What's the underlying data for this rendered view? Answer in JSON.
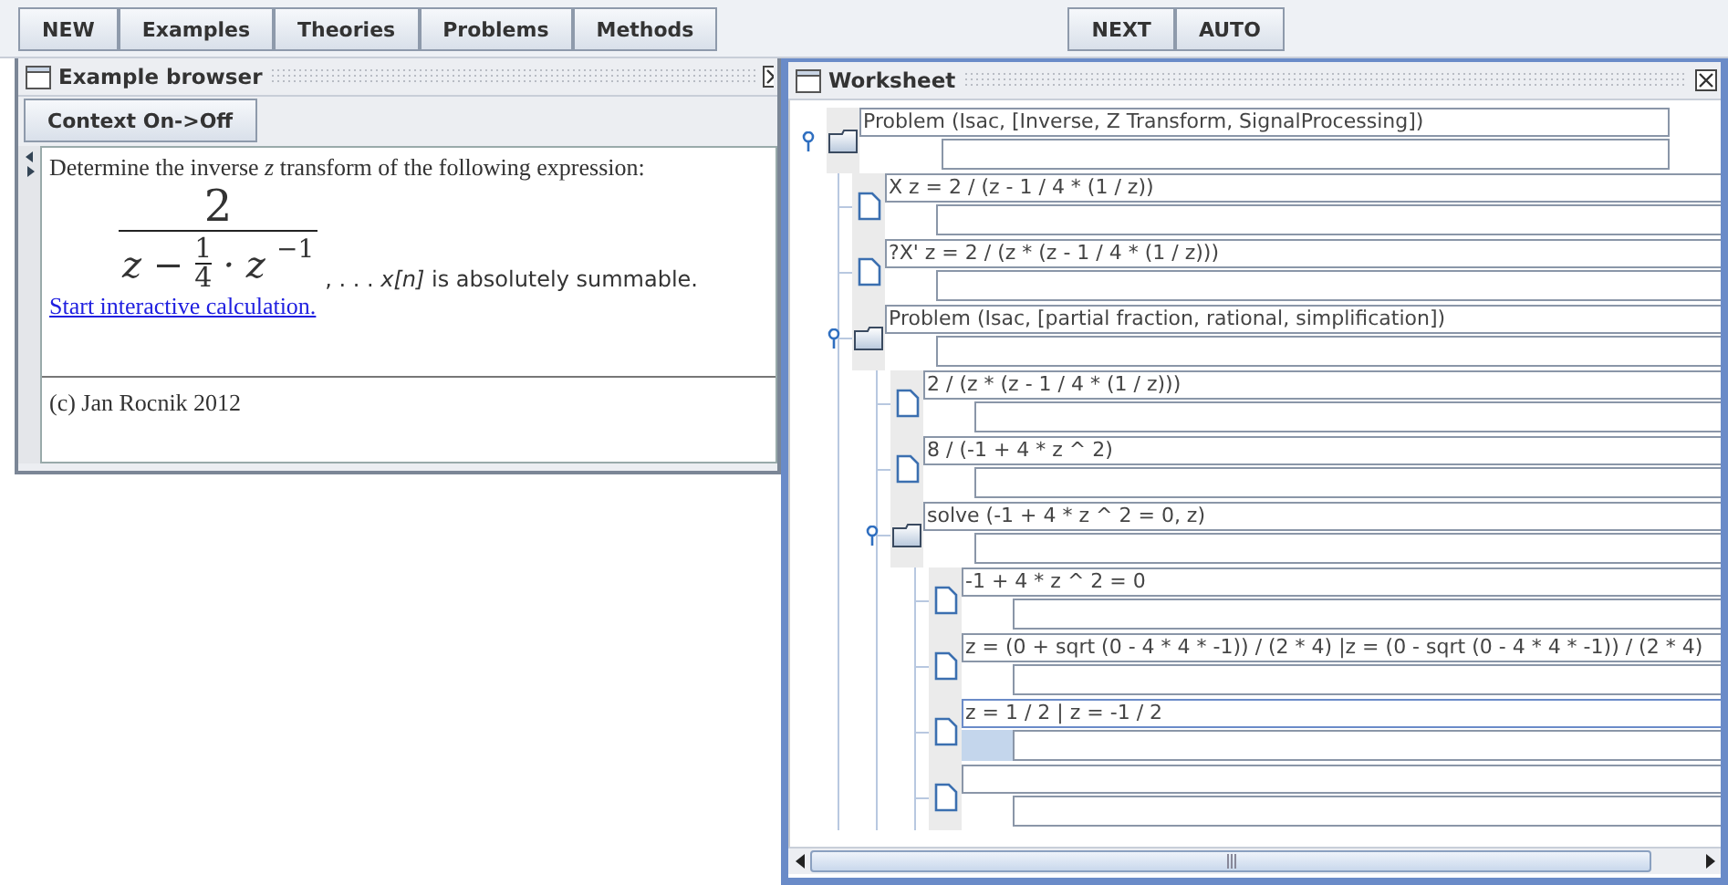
{
  "toolbar": {
    "left_buttons": [
      "NEW",
      "Examples",
      "Theories",
      "Problems",
      "Methods"
    ],
    "right_buttons": [
      "NEXT",
      "AUTO"
    ]
  },
  "example_browser": {
    "title": "Example browser",
    "context_button": "Context On->Off",
    "intro": "Determine the inverse *z* transform of the following expression:",
    "formula": {
      "numerator": "2",
      "lead": "z −",
      "frac_num": "1",
      "frac_den": "4",
      "tail": "· z",
      "exponent": "−1"
    },
    "suffix": ", . . . *x[n]* is absolutely summable.",
    "link": "Start interactive calculation.",
    "footer": "(c)  Jan Rocnik 2012"
  },
  "worksheet": {
    "title": "Worksheet",
    "tree": [
      {
        "kind": "problem",
        "formula": "Problem (Isac, [Inverse, Z Transform, SignalProcessing])",
        "expanded": true,
        "selected": false,
        "children": [
          {
            "kind": "step",
            "formula": "X z = 2 / (z - 1 / 4 * (1 / z))",
            "selected": false
          },
          {
            "kind": "step",
            "formula": "?X' z = 2 / (z * (z - 1 / 4 * (1 / z)))",
            "selected": false
          },
          {
            "kind": "problem",
            "formula": "Problem (Isac, [partial fraction, rational, simplification])",
            "expanded": true,
            "selected": false,
            "children": [
              {
                "kind": "step",
                "formula": "2 / (z * (z - 1 / 4 * (1 / z)))",
                "selected": false
              },
              {
                "kind": "step",
                "formula": "8 / (-1 + 4 * z ^ 2)",
                "selected": false
              },
              {
                "kind": "problem",
                "formula": "solve (-1 + 4 * z ^ 2 = 0, z)",
                "expanded": true,
                "selected": false,
                "children": [
                  {
                    "kind": "step",
                    "formula": "-1 + 4 * z ^ 2 = 0",
                    "selected": false
                  },
                  {
                    "kind": "step",
                    "formula": "z = (0 + sqrt (0 - 4 * 4 * -1)) / (2 * 4) |z = (0 - sqrt (0 - 4 * 4 * -1)) / (2 * 4)",
                    "selected": false
                  },
                  {
                    "kind": "step",
                    "formula": "z = 1 / 2 | z = -1 / 2",
                    "selected": true
                  },
                  {
                    "kind": "step",
                    "selected": false
                  }
                ]
              }
            ]
          }
        ]
      }
    ]
  }
}
